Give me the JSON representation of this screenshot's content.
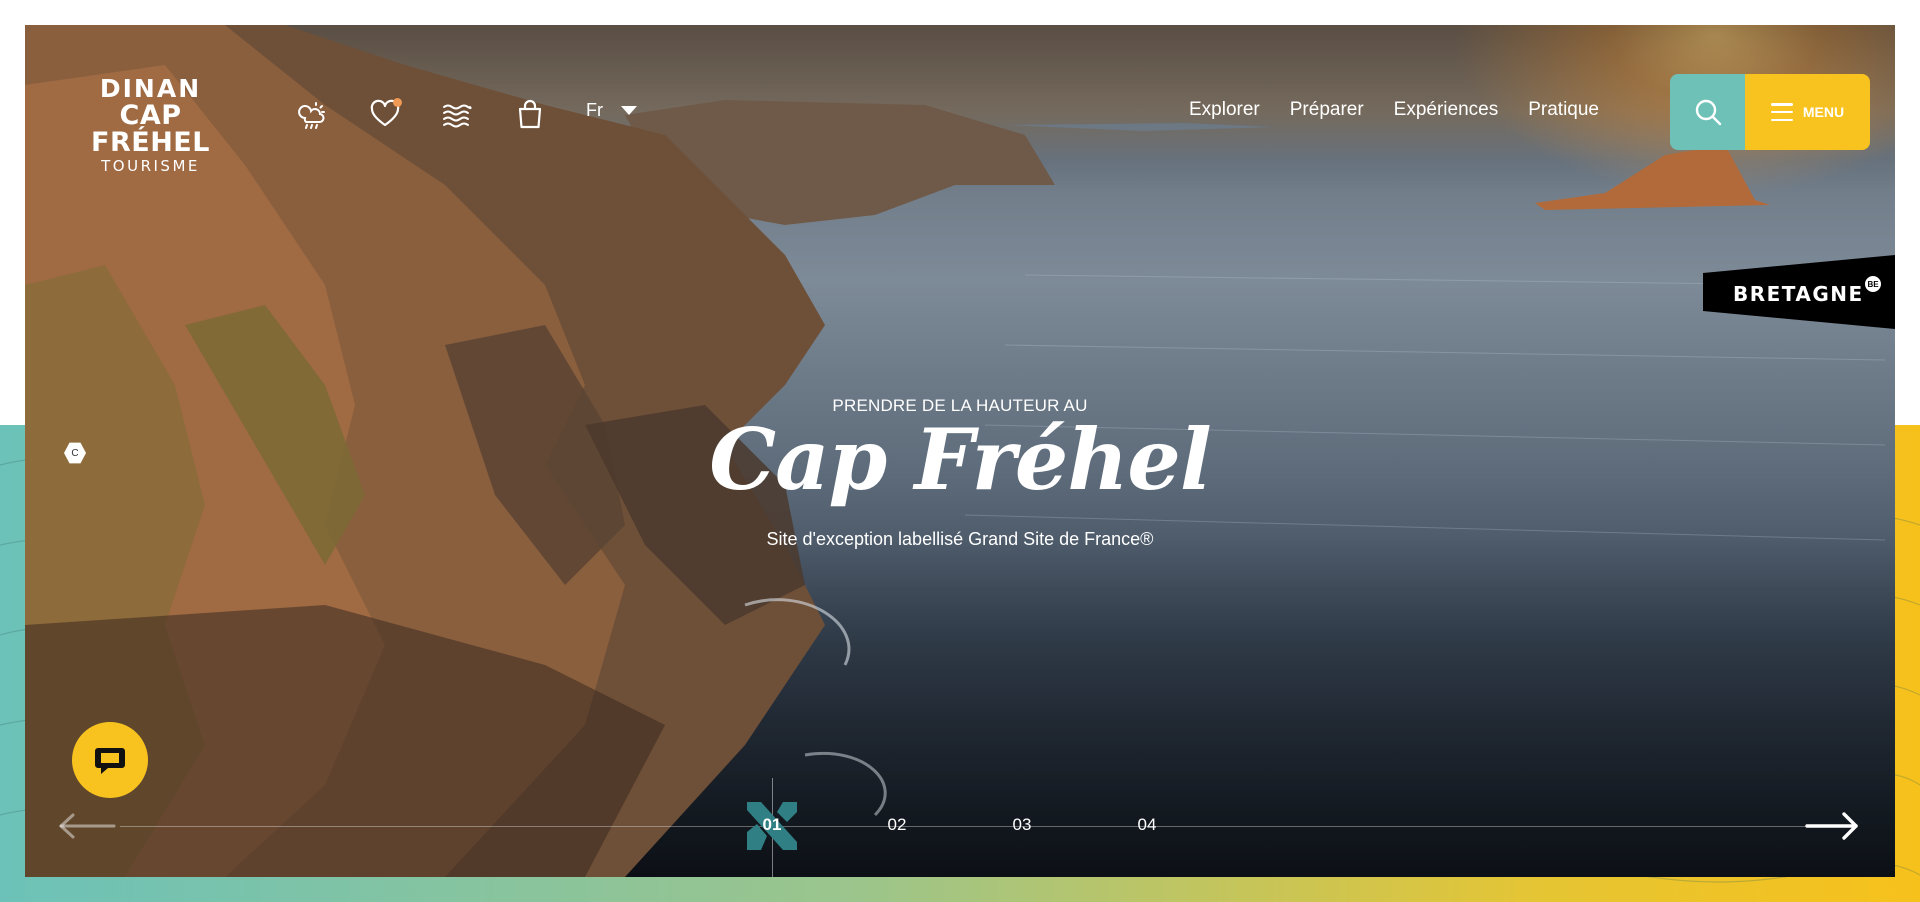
{
  "brand": {
    "line1": "DINAN",
    "line2": "CAP FRÉHEL",
    "line3": "TOURISME"
  },
  "header": {
    "icons": [
      "weather-icon",
      "heart-icon",
      "sea-waves-icon",
      "shopping-bag-icon"
    ],
    "language": "Fr",
    "nav": [
      "Explorer",
      "Préparer",
      "Expériences",
      "Pratique"
    ],
    "menu_label": "MENU"
  },
  "badge": {
    "label": "BRETAGNE",
    "mark": "BE"
  },
  "credit": "C",
  "hero": {
    "kicker": "PRENDRE DE LA HAUTEUR AU",
    "title": "Cap Fréhel",
    "subtitle": "Site d'exception labellisé Grand Site de France®"
  },
  "slider": {
    "slides": [
      "01",
      "02",
      "03",
      "04"
    ],
    "active_index": 0
  },
  "colors": {
    "teal": "#6dc1b7",
    "yellow": "#f8c31e",
    "teal_dark": "#2f7f84"
  }
}
